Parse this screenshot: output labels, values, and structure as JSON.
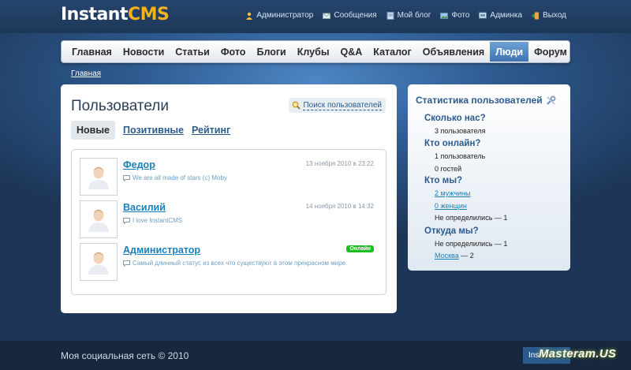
{
  "logo": {
    "part1": "Instant",
    "part2": "CMS"
  },
  "toplinks": [
    {
      "label": "Администратор",
      "icon": "user-icon"
    },
    {
      "label": "Сообщения",
      "icon": "mail-icon"
    },
    {
      "label": "Мой блог",
      "icon": "blog-icon"
    },
    {
      "label": "Фото",
      "icon": "photo-icon"
    },
    {
      "label": "Админка",
      "icon": "admin-icon"
    },
    {
      "label": "Выход",
      "icon": "exit-icon"
    }
  ],
  "nav": [
    "Главная",
    "Новости",
    "Статьи",
    "Фото",
    "Блоги",
    "Клубы",
    "Q&A",
    "Каталог",
    "Объявления",
    "Люди",
    "Форум"
  ],
  "nav_active": "Люди",
  "breadcrumb": "Главная",
  "main": {
    "title": "Пользователи",
    "search_label": "Поиск пользователей",
    "tabs": [
      "Новые",
      "Позитивные",
      "Рейтинг"
    ],
    "users": [
      {
        "name": "Федор",
        "status": "We are all made of stars (c) Moby",
        "date": "13 ноября 2010 в 23:22"
      },
      {
        "name": "Василий",
        "status": "I love InstantCMS",
        "date": "14 ноября 2010 в 14:32"
      },
      {
        "name": "Администратор",
        "status": "Самый длинный статус из всех что существуют в этом прекрасном мире",
        "badge": "Онлайн"
      }
    ]
  },
  "sidebar": {
    "title": "Статистика пользователей",
    "sections": {
      "count": {
        "title": "Сколько нас?",
        "line1": "3 пользователя"
      },
      "online": {
        "title": "Кто онлайн?",
        "line1": "1 пользователь",
        "line2": "0 гостей"
      },
      "who": {
        "title": "Кто мы?",
        "male": "2 мужчины",
        "female": "0 женщин",
        "undefined": "Не определились — 1"
      },
      "where": {
        "title": "Откуда мы?",
        "undefined": "Не определились — 1",
        "city": "Москва",
        "city_count": "— 2"
      }
    }
  },
  "footer": {
    "copyright": "Моя социальная сеть © 2010",
    "badge": "Ins",
    "watermark": "Masteram.US"
  },
  "colors": {
    "link": "#1a7fb9",
    "heading": "#2b5a8d",
    "online": "#1bbf26",
    "nav_active": "#4f86c2"
  }
}
